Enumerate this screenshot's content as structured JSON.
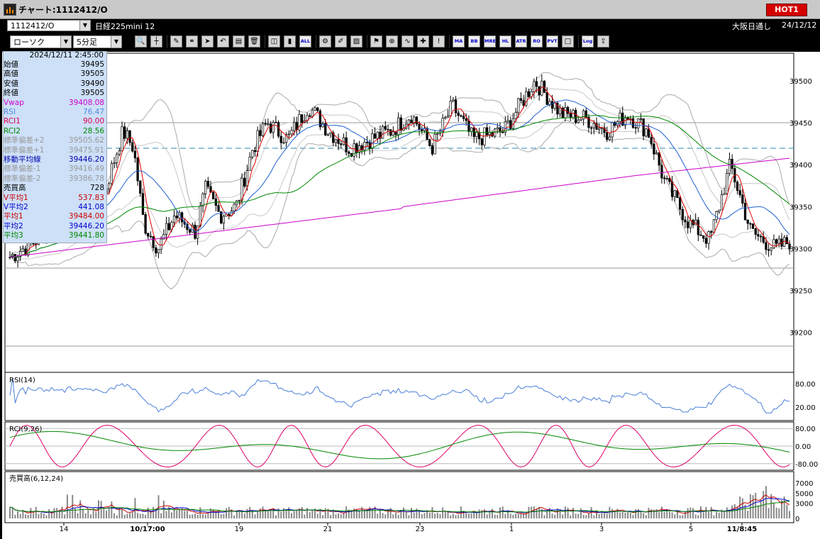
{
  "window": {
    "title": "チャート:1112412/O",
    "hot_label": "HOT1"
  },
  "header": {
    "symbol_code": "1112412/O",
    "symbol_name": "日経225mini 12",
    "session": "大阪日通し",
    "date": "24/12/12",
    "chart_type": "ローソク",
    "interval": "5分足"
  },
  "toolbar": {
    "buttons": [
      "zoom",
      "cursor-lines",
      "pencil",
      "link",
      "pointer",
      "undo",
      "notes",
      "trash",
      "candle-mode",
      "red-candle",
      "all-bars",
      "settings",
      "brush",
      "color",
      "alert",
      "search",
      "average",
      "mark",
      "info",
      "MA",
      "BB",
      "MRE",
      "HL",
      "ATR",
      "RO",
      "PVT",
      "square",
      "Log",
      "export"
    ]
  },
  "info_panel": {
    "datetime": "2024/12/11 2:45:00",
    "rows": [
      {
        "label": "始値",
        "value": "39495",
        "color": "#000000"
      },
      {
        "label": "高値",
        "value": "39505",
        "color": "#000000"
      },
      {
        "label": "安値",
        "value": "39490",
        "color": "#000000"
      },
      {
        "label": "終値",
        "value": "39505",
        "color": "#000000"
      },
      {
        "label": "Vwap",
        "value": "39408.08",
        "color": "#cc00cc"
      },
      {
        "label": "RSI",
        "value": "76.47",
        "color": "#5588dd"
      },
      {
        "label": "RCI1",
        "value": "90.00",
        "color": "#dd0055"
      },
      {
        "label": "RCI2",
        "value": "28.56",
        "color": "#008800"
      },
      {
        "label": "標準偏差+2",
        "value": "39505.62",
        "color": "#999999"
      },
      {
        "label": "標準偏差+1",
        "value": "39475.91",
        "color": "#999999"
      },
      {
        "label": "移動平均線",
        "value": "39446.20",
        "color": "#0000aa"
      },
      {
        "label": "標準偏差-1",
        "value": "39416.49",
        "color": "#999999"
      },
      {
        "label": "標準偏差-2",
        "value": "39386.78",
        "color": "#999999"
      },
      {
        "label": "売買高",
        "value": "728",
        "color": "#000000"
      },
      {
        "label": "V平均1",
        "value": "537.83",
        "color": "#cc0000"
      },
      {
        "label": "V平均2",
        "value": "441.08",
        "color": "#0000cc"
      },
      {
        "label": "平均1",
        "value": "39484.00",
        "color": "#cc0000"
      },
      {
        "label": "平均2",
        "value": "39446.20",
        "color": "#0000cc"
      },
      {
        "label": "平均3",
        "value": "39441.80",
        "color": "#008800"
      }
    ]
  },
  "price_axis": {
    "labels": [
      "39500",
      "39450",
      "39400",
      "39350",
      "39300",
      "39250",
      "39200"
    ]
  },
  "dashed_level": 39420,
  "rsi_panel": {
    "label": "RSI(14)",
    "axis": [
      "80.00",
      "20.00"
    ]
  },
  "rci_panel": {
    "label": "RCI(9,26)",
    "axis": [
      "80.00",
      "0.00",
      "-80.00"
    ]
  },
  "vol_panel": {
    "label": "売買高(6,12,24)",
    "axis": [
      "7000",
      "5000",
      "3000",
      "0"
    ]
  },
  "time_axis": {
    "labels": [
      "14",
      "10/17:00",
      "19",
      "21",
      "23",
      "1",
      "3",
      "5",
      "11/8:45"
    ]
  },
  "colors": {
    "up": "#000000",
    "down": "#000000",
    "ma_short": "#dd0000",
    "ma_mid": "#1e5fd0",
    "ma_long": "#008800",
    "vwap": "#cc00cc",
    "band": "#aaaaaa",
    "rsi": "#4a7fd8",
    "rci1": "#e0006a",
    "rci2": "#008800"
  }
}
